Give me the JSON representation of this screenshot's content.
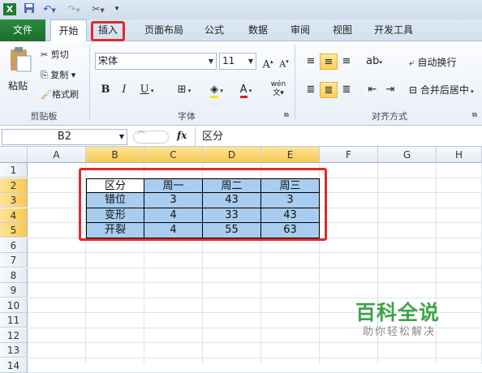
{
  "qat": {
    "excel_icon": "excel-logo-icon",
    "save_icon": "save-icon",
    "undo_icon": "undo-icon",
    "redo_icon": "redo-icon",
    "tools_icon": "tools-icon",
    "customize_icon": "customize-qat-icon"
  },
  "tabs": {
    "file": "文件",
    "home": "开始",
    "insert": "插入",
    "page_layout": "页面布局",
    "formulas": "公式",
    "data": "数据",
    "review": "审阅",
    "view": "视图",
    "developer": "开发工具"
  },
  "clipboard": {
    "paste": "粘贴",
    "cut": "剪切",
    "copy": "复制",
    "format_painter": "格式刷",
    "group_label": "剪贴板"
  },
  "font": {
    "font_name": "宋体",
    "font_size": "11",
    "bold": "B",
    "italic": "I",
    "underline": "U",
    "phonetic": "wén",
    "group_label": "字体"
  },
  "alignment": {
    "wrap_text": "自动换行",
    "merge_center": "合并后居中",
    "group_label": "对齐方式"
  },
  "formula_bar": {
    "name_box": "B2",
    "fx": "fx",
    "content": "区分"
  },
  "sheet": {
    "columns": [
      "A",
      "B",
      "C",
      "D",
      "E",
      "F",
      "G",
      "H"
    ],
    "rows": [
      "1",
      "2",
      "3",
      "4",
      "5",
      "6",
      "7",
      "8",
      "9",
      "10",
      "11",
      "12",
      "13",
      "14"
    ],
    "table": [
      [
        "区分",
        "周一",
        "周二",
        "周三"
      ],
      [
        "错位",
        "3",
        "43",
        "3"
      ],
      [
        "变形",
        "4",
        "33",
        "43"
      ],
      [
        "开裂",
        "4",
        "55",
        "63"
      ]
    ]
  },
  "watermark": {
    "title": "百科全说",
    "subtitle": "助你轻松解决"
  },
  "colors": {
    "highlight": "#e02a2a",
    "selection": "#a8cdee",
    "file_tab": "#1f7b33"
  }
}
